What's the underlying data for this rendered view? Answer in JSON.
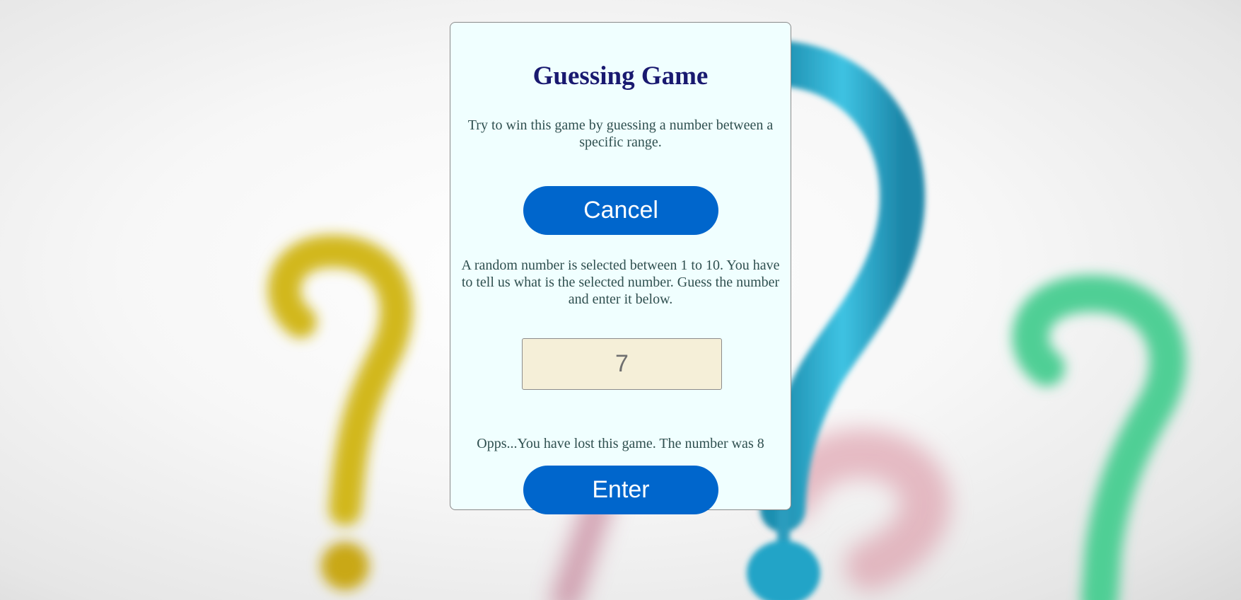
{
  "game": {
    "title": "Guessing Game",
    "intro": "Try to win this game by guessing a number between a specific range.",
    "cancel_label": "Cancel",
    "instructions": "A random number is selected between 1 to 10. You have to tell us what is the selected number. Guess the number and enter it below.",
    "guess_value": "7",
    "result_message": "Opps...You have lost this game. The number was 8",
    "enter_label": "Enter"
  },
  "colors": {
    "card_background": "#f0ffff",
    "title": "#191970",
    "text": "#2f4f4f",
    "button": "#0066cc",
    "input_background": "#f5efd8"
  },
  "background_icons": [
    "yellow-question-mark-icon",
    "teal-question-mark-icon",
    "green-question-mark-icon",
    "pink-question-mark-icon"
  ]
}
